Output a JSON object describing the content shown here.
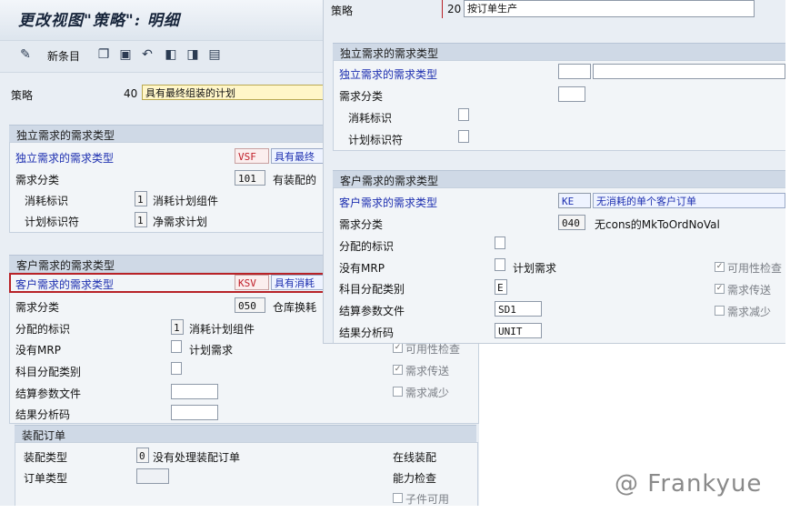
{
  "back": {
    "title": "更改视图\"策略\": 明细",
    "toolbar": {
      "new_entries": "新条目",
      "icons": [
        "glasses-icon",
        "copy-icon",
        "save-copy-icon",
        "undo-icon",
        "prev-entry-icon",
        "next-entry-icon",
        "print-icon"
      ]
    },
    "strategy": {
      "label": "策略",
      "code": "40",
      "text": "具有最终组装的计划"
    },
    "indep": {
      "header": "独立需求的需求类型",
      "type_label": "独立需求的需求类型",
      "type_code": "VSF",
      "type_text": "具有最终",
      "class_label": "需求分类",
      "class_code": "101",
      "class_text": "有装配的",
      "consumption_label": "消耗标识",
      "consumption_value": "1",
      "consumption_text": "消耗计划组件",
      "plan_ind_label": "计划标识符",
      "plan_ind_value": "1",
      "plan_ind_text": "净需求计划"
    },
    "cust": {
      "header": "客户需求的需求类型",
      "type_label": "客户需求的需求类型",
      "type_code": "KSV",
      "type_text": "具有消耗",
      "class_label": "需求分类",
      "class_code": "050",
      "class_text": "仓库换耗",
      "alloc_label": "分配的标识",
      "alloc_value": "1",
      "alloc_text": "消耗计划组件",
      "no_mrp_label": "没有MRP",
      "no_mrp_text": "计划需求",
      "acct_label": "科目分配类别",
      "settle_label": "结算参数文件",
      "result_label": "结果分析码",
      "avail_check": "可用性检查",
      "req_transfer": "需求传送",
      "req_reduce": "需求减少"
    },
    "assembly": {
      "header": "装配订单",
      "type_label": "装配类型",
      "type_value": "0",
      "type_text": "没有处理装配订单",
      "order_type_label": "订单类型",
      "online_label": "在线装配",
      "capacity_label": "能力检查",
      "component_label": "子件可用"
    }
  },
  "front": {
    "strategy": {
      "label": "策略",
      "code": "20",
      "text": "按订单生产"
    },
    "indep": {
      "header": "独立需求的需求类型",
      "type_label": "独立需求的需求类型",
      "class_label": "需求分类",
      "consumption_label": "消耗标识",
      "plan_ind_label": "计划标识符"
    },
    "cust": {
      "header": "客户需求的需求类型",
      "type_label": "客户需求的需求类型",
      "type_code": "KE",
      "type_text": "无消耗的单个客户订单",
      "class_label": "需求分类",
      "class_code": "040",
      "class_text": "无cons的MkToOrdNoVal",
      "alloc_label": "分配的标识",
      "no_mrp_label": "没有MRP",
      "no_mrp_text": "计划需求",
      "acct_label": "科目分配类别",
      "acct_value": "E",
      "settle_label": "结算参数文件",
      "settle_value": "SD1",
      "result_label": "结果分析码",
      "result_value": "UNIT",
      "avail_check": "可用性检查",
      "req_transfer": "需求传送",
      "req_reduce": "需求减少"
    }
  },
  "watermark": "@ Frankyue",
  "colors": {
    "label_blue": "#1d2fb0",
    "highlight_red": "#b82227",
    "section_header": "#cfd9e6"
  }
}
